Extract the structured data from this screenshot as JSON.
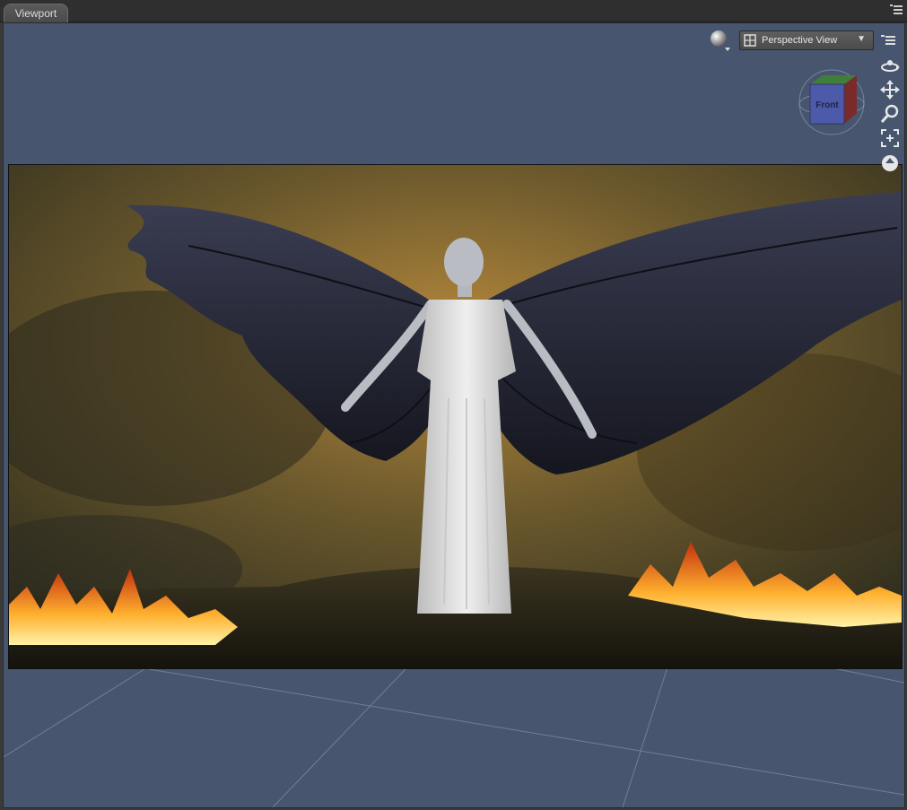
{
  "panel": {
    "tab_label": "Viewport"
  },
  "toolbar": {
    "view_label": "Perspective View",
    "dropdown_arrow": "▼"
  },
  "view_cube": {
    "face_label": "Front"
  },
  "icons": {
    "draw_style": "sphere-shading-icon",
    "camera": "camera-grid-icon",
    "orbit": "orbit-icon",
    "pan": "pan-icon",
    "zoom": "zoom-icon",
    "frame": "frame-icon",
    "more": "more-tools-icon",
    "options": "options-menu-icon"
  },
  "colors": {
    "viewport_bg": "#47556f",
    "grid_line": "#7a8aa3",
    "tab_bg": "#4f4f4f"
  }
}
